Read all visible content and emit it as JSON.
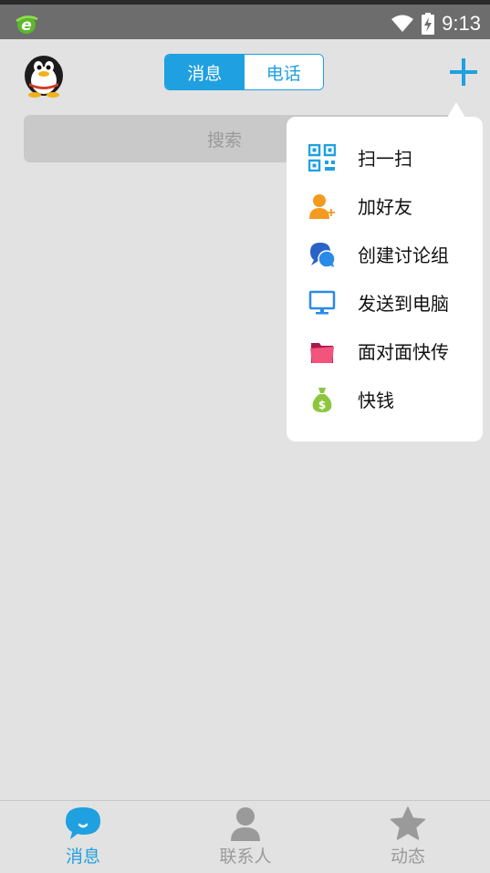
{
  "status_bar": {
    "time": "9:13"
  },
  "header": {
    "tabs": [
      {
        "label": "消息",
        "active": true
      },
      {
        "label": "电话",
        "active": false
      }
    ]
  },
  "search": {
    "placeholder": "搜索"
  },
  "popup_menu": {
    "items": [
      {
        "label": "扫一扫",
        "icon": "qr-code-icon"
      },
      {
        "label": "加好友",
        "icon": "add-friend-icon"
      },
      {
        "label": "创建讨论组",
        "icon": "discussion-group-icon"
      },
      {
        "label": "发送到电脑",
        "icon": "computer-icon"
      },
      {
        "label": "面对面快传",
        "icon": "folder-transfer-icon"
      },
      {
        "label": "快钱",
        "icon": "money-bag-icon"
      }
    ]
  },
  "bottom_nav": {
    "items": [
      {
        "label": "消息",
        "icon": "message-bubble-icon",
        "active": true
      },
      {
        "label": "联系人",
        "icon": "contact-person-icon",
        "active": false
      },
      {
        "label": "动态",
        "icon": "star-icon",
        "active": false
      }
    ]
  },
  "colors": {
    "accent": "#1fa0e0",
    "background": "#e2e2e2",
    "status_bar": "#6d6d6d"
  }
}
